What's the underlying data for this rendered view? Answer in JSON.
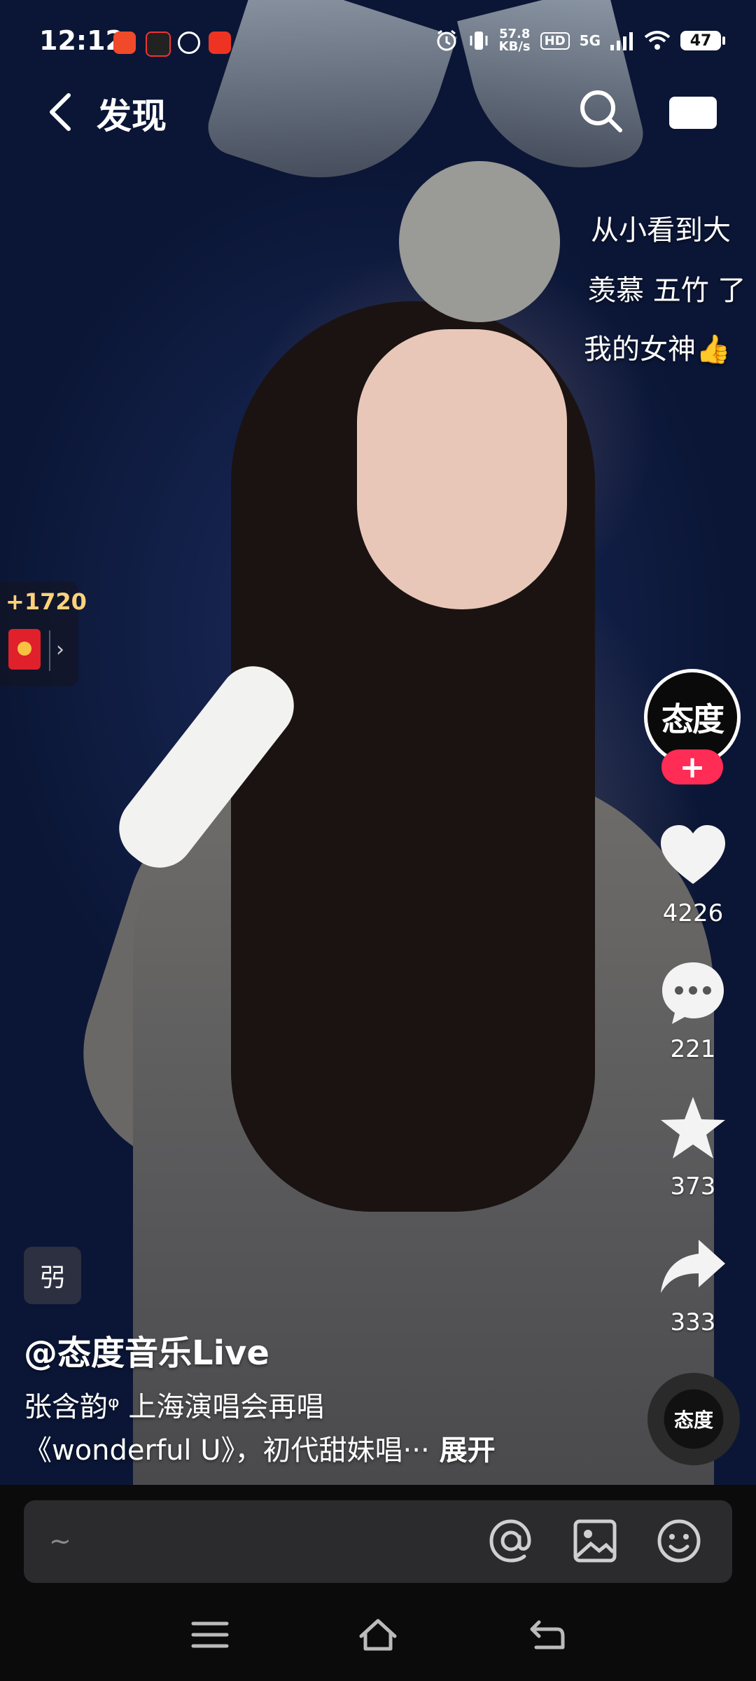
{
  "status_bar": {
    "time": "12:12",
    "net_speed_value": "57.8",
    "net_speed_unit": "KB/s",
    "hd": "HD",
    "network": "5G",
    "battery": "47"
  },
  "nav": {
    "title": "发现"
  },
  "danmaku": [
    "从小看到大",
    "羡慕 五竹 了",
    "我的女神👍"
  ],
  "reward": {
    "amount": "+1720"
  },
  "rail": {
    "avatar_text": "态度",
    "follow": "+",
    "likes": "4226",
    "comments": "221",
    "favorites": "373",
    "shares": "333"
  },
  "music": {
    "disc_text": "态度"
  },
  "post": {
    "tag": "弜",
    "author": "@态度音乐Live",
    "desc_line1": "张含韵ᵠ 上海演唱会再唱",
    "desc_line2": "《wonderful U》，初代甜妹唱···",
    "expand": "展开"
  },
  "comment_bar": {
    "placeholder": "~"
  },
  "colors": {
    "accent": "#ff2c55",
    "reward": "#ffd27a",
    "background": "#0d1838"
  }
}
